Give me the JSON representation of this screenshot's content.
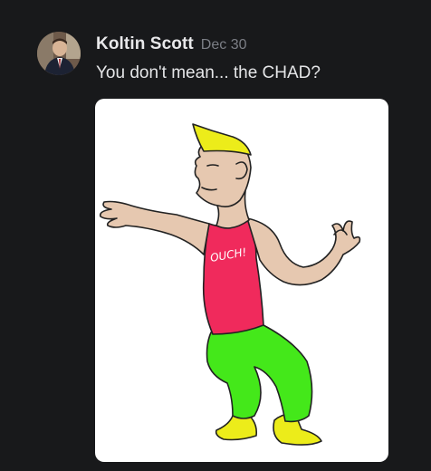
{
  "post": {
    "author": "Koltin Scott",
    "date": "Dec 30",
    "message": "You don't mean... the CHAD?",
    "attachment": {
      "shirt_text": "OUCH!"
    }
  },
  "colors": {
    "background": "#18191b",
    "author_text": "#e8e8ea",
    "date_text": "#7b7e85",
    "skin": "#e6c8b0",
    "hair": "#ecec1a",
    "shirt": "#f02a5c",
    "pants": "#44e81a",
    "shoes": "#ecec1a"
  }
}
